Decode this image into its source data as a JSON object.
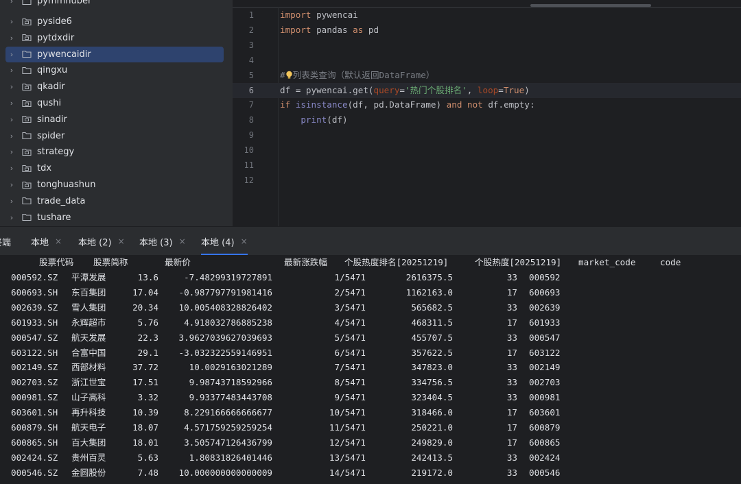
{
  "project_tree": {
    "partial_top_label": "pymmhuber",
    "items": [
      {
        "label": "pyside6",
        "icon": "module-folder-icon",
        "selected": false
      },
      {
        "label": "pytdxdir",
        "icon": "module-folder-icon",
        "selected": false
      },
      {
        "label": "pywencaidir",
        "icon": "folder-icon",
        "selected": true
      },
      {
        "label": "qingxu",
        "icon": "folder-icon",
        "selected": false
      },
      {
        "label": "qkadir",
        "icon": "module-folder-icon",
        "selected": false
      },
      {
        "label": "qushi",
        "icon": "module-folder-icon",
        "selected": false
      },
      {
        "label": "sinadir",
        "icon": "module-folder-icon",
        "selected": false
      },
      {
        "label": "spider",
        "icon": "folder-icon",
        "selected": false
      },
      {
        "label": "strategy",
        "icon": "module-folder-icon",
        "selected": false
      },
      {
        "label": "tdx",
        "icon": "module-folder-icon",
        "selected": false
      },
      {
        "label": "tonghuashun",
        "icon": "module-folder-icon",
        "selected": false
      },
      {
        "label": "trade_data",
        "icon": "folder-icon",
        "selected": false
      },
      {
        "label": "tushare",
        "icon": "folder-icon",
        "selected": false
      }
    ]
  },
  "editor": {
    "current_line": 6,
    "line_numbers": [
      "1",
      "2",
      "3",
      "4",
      "5",
      "6",
      "7",
      "8",
      "9",
      "10",
      "11",
      "12"
    ],
    "lines": [
      {
        "tokens": [
          {
            "t": "import",
            "c": "kw"
          },
          {
            "t": " pywencai",
            "c": ""
          }
        ]
      },
      {
        "tokens": [
          {
            "t": "import",
            "c": "kw"
          },
          {
            "t": " pandas ",
            "c": ""
          },
          {
            "t": "as",
            "c": "kw"
          },
          {
            "t": " pd",
            "c": ""
          }
        ]
      },
      {
        "tokens": []
      },
      {
        "tokens": []
      },
      {
        "tokens": [
          {
            "t": "#",
            "c": "cmt"
          },
          {
            "t": "BULB",
            "c": "bulb"
          },
          {
            "t": "列表类查询（默认返回DataFrame）",
            "c": "cmt"
          }
        ]
      },
      {
        "tokens": [
          {
            "t": "df = pywencai.get(",
            "c": ""
          },
          {
            "t": "query",
            "c": "param"
          },
          {
            "t": "=",
            "c": ""
          },
          {
            "t": "'热门个股排名'",
            "c": "str"
          },
          {
            "t": ", ",
            "c": ""
          },
          {
            "t": "loop",
            "c": "param"
          },
          {
            "t": "=",
            "c": ""
          },
          {
            "t": "True",
            "c": "kw"
          },
          {
            "t": ")",
            "c": ""
          }
        ]
      },
      {
        "tokens": [
          {
            "t": "if",
            "c": "kw"
          },
          {
            "t": " ",
            "c": ""
          },
          {
            "t": "isinstance",
            "c": "builtin"
          },
          {
            "t": "(df, pd.DataFrame) ",
            "c": ""
          },
          {
            "t": "and not",
            "c": "kw"
          },
          {
            "t": " df.empty:",
            "c": ""
          }
        ]
      },
      {
        "tokens": [
          {
            "t": "    ",
            "c": ""
          },
          {
            "t": "print",
            "c": "builtin"
          },
          {
            "t": "(df)",
            "c": ""
          }
        ]
      },
      {
        "tokens": []
      },
      {
        "tokens": []
      },
      {
        "tokens": []
      },
      {
        "tokens": []
      }
    ]
  },
  "terminal": {
    "title": "终端",
    "tabs": [
      {
        "label": "本地",
        "active": false
      },
      {
        "label": "本地 (2)",
        "active": false
      },
      {
        "label": "本地 (3)",
        "active": false
      },
      {
        "label": "本地 (4)",
        "active": true
      }
    ],
    "close_glyph": "×",
    "headers": [
      "股票代码",
      "股票简称",
      "最新价",
      "最新涨跌幅",
      "个股热度排名[20251219]",
      "个股热度[20251219]",
      "market_code",
      "code"
    ],
    "rows": [
      [
        "000592.SZ",
        "平潭发展",
        "13.6",
        "-7.48299319727891",
        "1/5471",
        "2616375.5",
        "33",
        "000592"
      ],
      [
        "600693.SH",
        "东百集团",
        "17.04",
        "-0.987797791981416",
        "2/5471",
        "1162163.0",
        "17",
        "600693"
      ],
      [
        "002639.SZ",
        "雪人集团",
        "20.34",
        "10.005408328826402",
        "3/5471",
        "565682.5",
        "33",
        "002639"
      ],
      [
        "601933.SH",
        "永辉超市",
        "5.76",
        "4.918032786885238",
        "4/5471",
        "468311.5",
        "17",
        "601933"
      ],
      [
        "000547.SZ",
        "航天发展",
        "22.3",
        "3.9627039627039693",
        "5/5471",
        "455707.5",
        "33",
        "000547"
      ],
      [
        "603122.SH",
        "合富中国",
        "29.1",
        "-3.032322559146951",
        "6/5471",
        "357622.5",
        "17",
        "603122"
      ],
      [
        "002149.SZ",
        "西部材料",
        "37.72",
        "10.0029163021289",
        "7/5471",
        "347823.0",
        "33",
        "002149"
      ],
      [
        "002703.SZ",
        "浙江世宝",
        "17.51",
        "9.98743718592966",
        "8/5471",
        "334756.5",
        "33",
        "002703"
      ],
      [
        "000981.SZ",
        "山子高科",
        "3.32",
        "9.93377483443708",
        "9/5471",
        "323404.5",
        "33",
        "000981"
      ],
      [
        "603601.SH",
        "再升科技",
        "10.39",
        "8.229166666666677",
        "10/5471",
        "318466.0",
        "17",
        "603601"
      ],
      [
        "600879.SH",
        "航天电子",
        "18.07",
        "4.571759259259254",
        "11/5471",
        "250221.0",
        "17",
        "600879"
      ],
      [
        "600865.SH",
        "百大集团",
        "18.01",
        "3.505747126436799",
        "12/5471",
        "249829.0",
        "17",
        "600865"
      ],
      [
        "002424.SZ",
        "贵州百灵",
        "5.63",
        "1.80831826401446",
        "13/5471",
        "242413.5",
        "33",
        "002424"
      ],
      [
        "000546.SZ",
        "金圆股份",
        "7.48",
        "10.000000000000009",
        "14/5471",
        "219172.0",
        "33",
        "000546"
      ]
    ]
  }
}
